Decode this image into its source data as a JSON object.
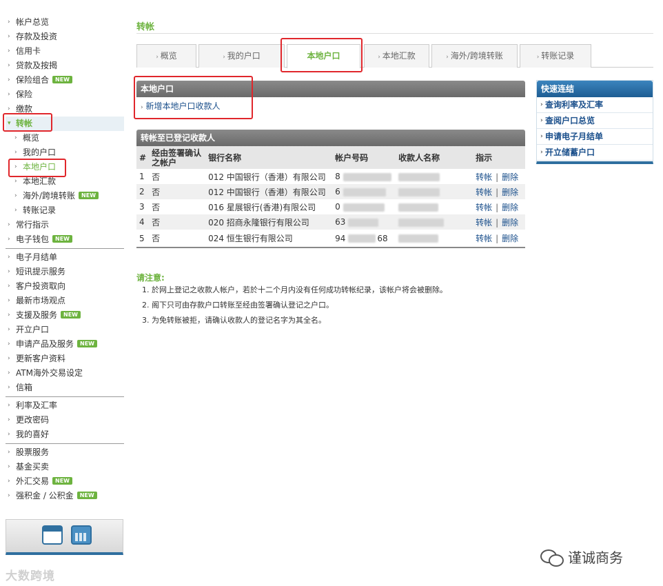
{
  "sidebar": {
    "groups": [
      [
        {
          "label": "帐户总览"
        },
        {
          "label": "存款及投资"
        },
        {
          "label": "信用卡"
        },
        {
          "label": "贷款及按揭"
        },
        {
          "label": "保险组合",
          "new": true
        },
        {
          "label": "保险"
        },
        {
          "label": "缴款"
        },
        {
          "label": "转帐",
          "state": "active-parent",
          "arrow": "down"
        },
        {
          "label": "概览",
          "sub": true
        },
        {
          "label": "我的户口",
          "sub": true
        },
        {
          "label": "本地户口",
          "sub": true,
          "state": "active-sub"
        },
        {
          "label": "本地汇款",
          "sub": true
        },
        {
          "label": "海外/跨境转账",
          "sub": true,
          "new": true
        },
        {
          "label": "转账记录",
          "sub": true
        },
        {
          "label": "常行指示"
        },
        {
          "label": "电子钱包",
          "new": true
        }
      ],
      [
        {
          "label": "电子月结单"
        },
        {
          "label": "短讯提示服务"
        },
        {
          "label": "客户投资取向"
        },
        {
          "label": "最新市场观点"
        },
        {
          "label": "支援及服务",
          "new": true
        },
        {
          "label": "开立户口"
        },
        {
          "label": "申请产品及服务",
          "new": true
        },
        {
          "label": "更新客户资料"
        },
        {
          "label": "ATM海外交易设定"
        },
        {
          "label": "信箱"
        }
      ],
      [
        {
          "label": "利率及汇率"
        },
        {
          "label": "更改密码"
        },
        {
          "label": "我的喜好"
        }
      ],
      [
        {
          "label": "股票服务"
        },
        {
          "label": "基金买卖"
        },
        {
          "label": "外汇交易",
          "new": true
        },
        {
          "label": "强积金 / 公积金",
          "new": true
        }
      ]
    ],
    "new_badge": "NEW"
  },
  "page_title": "转帐",
  "tabs": [
    {
      "label": "概览"
    },
    {
      "label": "我的户口"
    },
    {
      "label": "本地户口",
      "active": true
    },
    {
      "label": "本地汇款"
    },
    {
      "label": "海外/跨境转账"
    },
    {
      "label": "转账记录"
    }
  ],
  "local_account_panel": {
    "header": "本地户口",
    "add_link": "新增本地户口收款人"
  },
  "payee_panel": {
    "header": "转帐至已登记收款人",
    "columns": [
      "#",
      "经由签署确认之帐户",
      "银行名称",
      "帐户号码",
      "收款人名称",
      "指示"
    ],
    "rows": [
      {
        "no": "1",
        "signed": "否",
        "bank": "012 中国银行（香港）有限公司",
        "account": "8"
      },
      {
        "no": "2",
        "signed": "否",
        "bank": "012 中国银行（香港）有限公司",
        "account": "6"
      },
      {
        "no": "3",
        "signed": "否",
        "bank": "016 星展银行(香港)有限公司",
        "account": "0"
      },
      {
        "no": "4",
        "signed": "否",
        "bank": "020 招商永隆银行有限公司",
        "account": "63"
      },
      {
        "no": "5",
        "signed": "否",
        "bank": "024 恒生银行有限公司",
        "account": "94",
        "account_tail": "68"
      }
    ],
    "action_transfer": "转帐",
    "action_separator": "|",
    "action_delete": "删除"
  },
  "notes": {
    "title": "请注意:",
    "items": [
      "1. 於网上登记之收款人帐户，若於十二个月内没有任何成功转帐纪录，该帐户将会被删除。",
      "2. 阁下只可由存款户口转账至经由签署确认登记之户口。",
      "3. 为免转账被拒，请确认收款人的登记名字为其全名。"
    ]
  },
  "quick_links": {
    "header": "快速连结",
    "items": [
      "查询利率及汇率",
      "查阅户口总览",
      "申请电子月结单",
      "开立储蓄户口"
    ]
  },
  "watermark_left": "大数跨境",
  "watermark_right": "谨诚商务",
  "colors": {
    "accent_green": "#6db33f",
    "link_blue": "#1a4f8b",
    "highlight_red": "#e0262b",
    "header_blue": "#2f6f9f"
  }
}
